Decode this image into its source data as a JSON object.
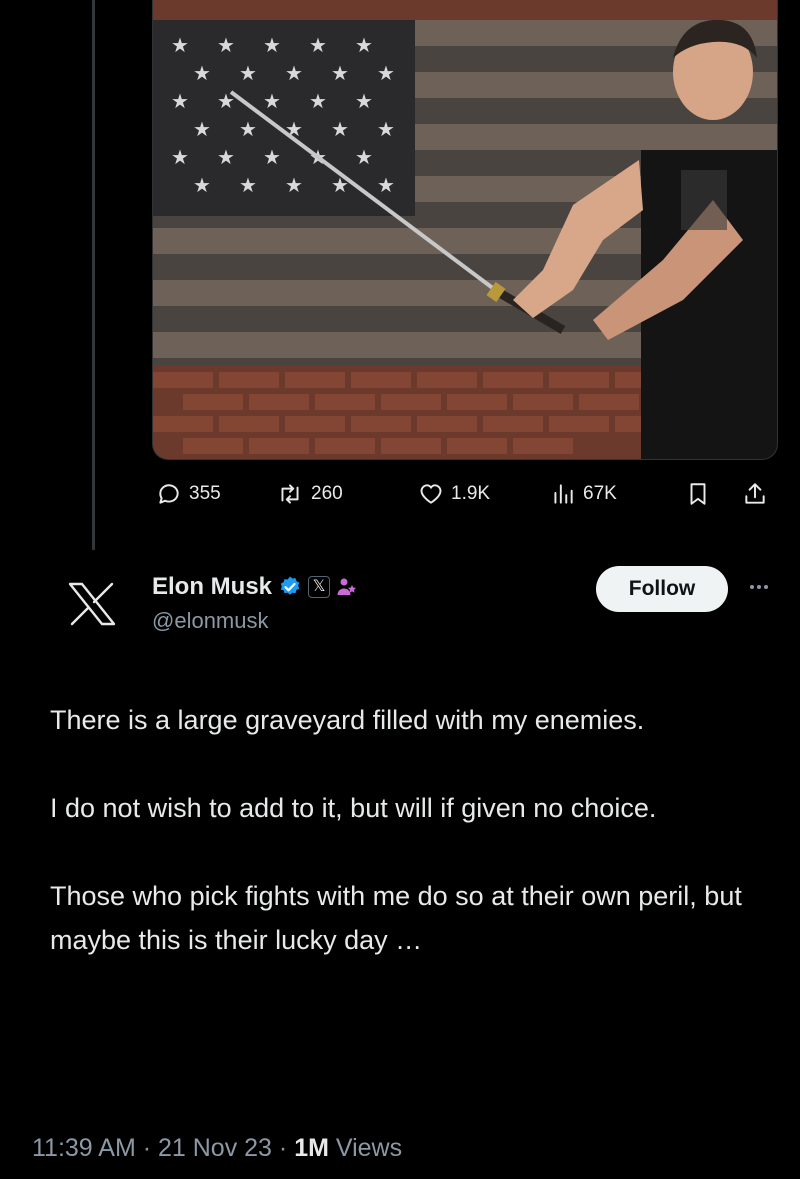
{
  "photo": {
    "description_icon": "image",
    "subject": "photo"
  },
  "actions": {
    "replies": "355",
    "reposts": "260",
    "likes": "1.9K",
    "views": "67K"
  },
  "author": {
    "name": "Elon Musk",
    "handle": "@elonmusk",
    "affiliate_badge": "𝕏",
    "verified_color": "#1d9bf0"
  },
  "follow_label": "Follow",
  "tweet": {
    "paragraphs": [
      "There is a large graveyard filled with my enemies.",
      "I do not wish to add to it, but will if given no choice.",
      "Those who pick fights with me do so at their own peril, but maybe this is their lucky day …"
    ]
  },
  "meta": {
    "time": "11:39 AM",
    "date": "21 Nov 23",
    "views_count": "1M",
    "views_label": "Views",
    "separator": " · "
  },
  "colors": {
    "background": "#000000",
    "text": "#e7e9ea",
    "muted": "#8b98a5",
    "accent": "#1d9bf0"
  }
}
